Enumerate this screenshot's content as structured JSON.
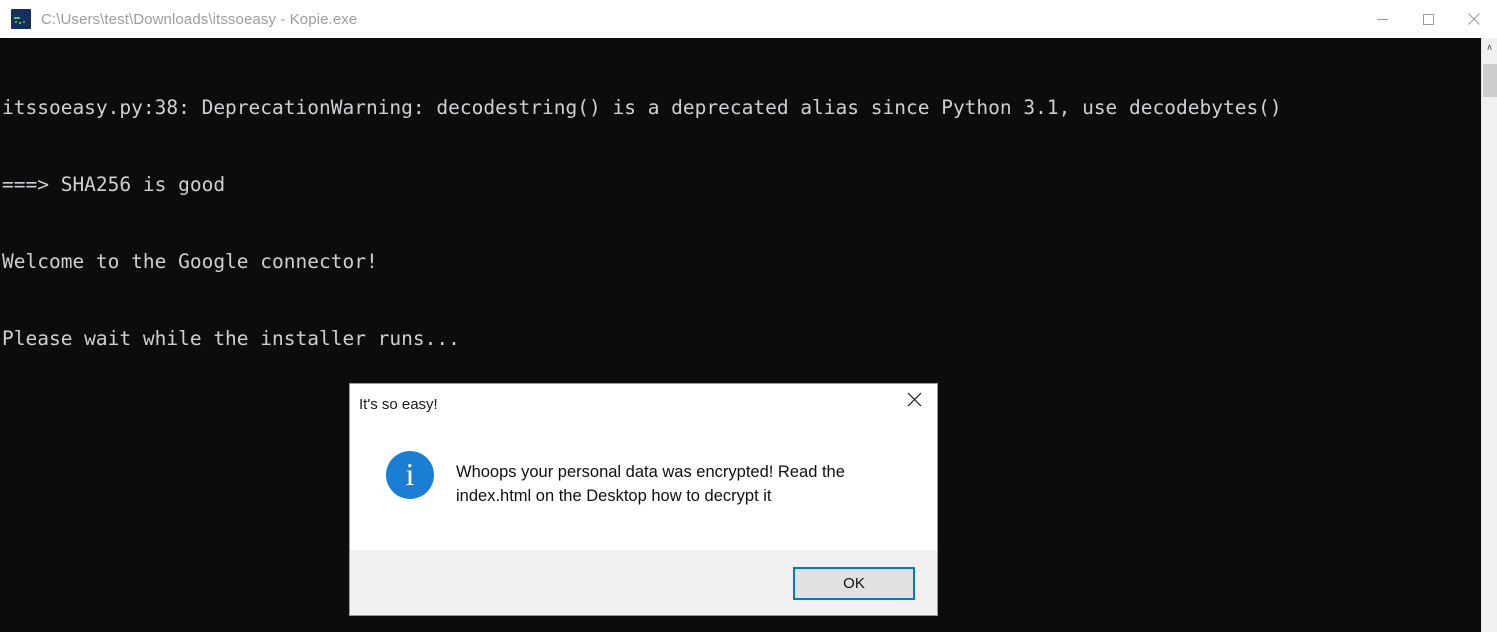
{
  "window": {
    "title": "C:\\Users\\test\\Downloads\\itssoeasy - Kopie.exe",
    "icon": "console-icon",
    "controls": {
      "minimize": "minimize-icon",
      "maximize": "maximize-icon",
      "close": "close-icon"
    }
  },
  "console": {
    "lines": [
      "itssoeasy.py:38: DeprecationWarning: decodestring() is a deprecated alias since Python 3.1, use decodebytes()",
      "===> SHA256 is good",
      "Welcome to the Google connector!",
      "Please wait while the installer runs..."
    ],
    "background_color": "#0c0c0c",
    "text_color": "#ccd0d4",
    "scrollbar": {
      "up_arrow": "∧"
    }
  },
  "dialog": {
    "title": "It's so easy!",
    "close_label": "✕",
    "icon": "info-icon",
    "icon_glyph": "i",
    "icon_color": "#1a7fd4",
    "message": "Whoops your personal data was encrypted! Read the index.html on the Desktop how to decrypt it",
    "ok_label": "OK",
    "focus_color": "#0078d7"
  }
}
